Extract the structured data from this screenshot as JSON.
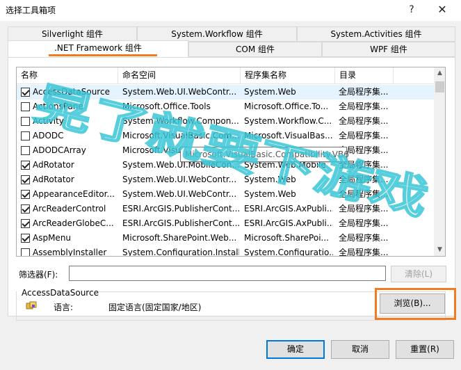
{
  "window": {
    "title": "选择工具箱项",
    "help_glyph": "?",
    "close_glyph": "✕"
  },
  "tabs": {
    "row1": [
      "Silverlight 组件",
      "System.Workflow 组件",
      "System.Activities 组件"
    ],
    "row2": [
      ".NET Framework 组件",
      "COM 组件",
      "WPF 组件"
    ],
    "active": ".NET Framework 组件"
  },
  "list": {
    "columns": [
      "名称",
      "命名空间",
      "程序集名称",
      "目录"
    ],
    "rows": [
      {
        "checked": true,
        "name": "AccessDataSource",
        "namespace": "System.Web.UI.WebContr...",
        "assembly": "System.Web",
        "dir": "全局程序集...",
        "selected": true
      },
      {
        "checked": false,
        "name": "ActionsPane",
        "namespace": "Microsoft.Office.Tools",
        "assembly": "Microsoft.Office.To...",
        "dir": "全局程序集..."
      },
      {
        "checked": false,
        "name": "Activity",
        "namespace": "System.Workflow.Compon...",
        "assembly": "System.Workflow.C...",
        "dir": "全局程序集..."
      },
      {
        "checked": false,
        "name": "ADODC",
        "namespace": "Microsoft.VisualBasic.Com...",
        "assembly": "Microsoft.VisualBas...",
        "dir": "全局程序集..."
      },
      {
        "checked": false,
        "name": "ADODCArray",
        "namespace": "Microsoft.Visual",
        "assembly": "",
        "dir": "全局程序集..."
      },
      {
        "checked": true,
        "name": "AdRotator",
        "namespace": "System.Web.UI.MobileCon...",
        "assembly": "System.Web.Mobile",
        "dir": "全局程序集..."
      },
      {
        "checked": true,
        "name": "AdRotator",
        "namespace": "System.Web.UI.WebContr...",
        "assembly": "System.Web",
        "dir": "全局程序集..."
      },
      {
        "checked": true,
        "name": "AppearanceEditor...",
        "namespace": "System.Web.UI.WebContr...",
        "assembly": "System.Web",
        "dir": "全局程序集..."
      },
      {
        "checked": true,
        "name": "ArcReaderControl",
        "namespace": "ESRI.ArcGIS.PublisherCont...",
        "assembly": "ESRI.ArcGIS.AxPubli...",
        "dir": "全局程序集..."
      },
      {
        "checked": true,
        "name": "ArcReaderGlobeC...",
        "namespace": "ESRI.ArcGIS.PublisherCont...",
        "assembly": "ESRI.ArcGIS.AxPubli...",
        "dir": "全局程序集..."
      },
      {
        "checked": true,
        "name": "AspMenu",
        "namespace": "Microsoft.SharePoint.Web...",
        "assembly": "Microsoft.SharePoi...",
        "dir": "全局程序集..."
      },
      {
        "checked": false,
        "name": "AssemblyInstaller",
        "namespace": "System.Configuration.Install",
        "assembly": "System.Configuratio...",
        "dir": "全局程序集..."
      }
    ],
    "tooltip": "Microsoft.VisualBasic.Compatibility.VB6",
    "scroll_up": "▲",
    "scroll_down": "▼"
  },
  "filter": {
    "label": "筛选器(F):",
    "value": "",
    "clear_label": "清除(L)"
  },
  "details": {
    "title": "AccessDataSource",
    "language_label": "语言:",
    "language_value": "固定语言(固定国家/地区)",
    "browse_label": "浏览(B)..."
  },
  "buttons": {
    "ok": "确定",
    "cancel": "取消",
    "reset": "重置(R)"
  },
  "watermark": {
    "text": "晃了就要下游戏"
  },
  "colors": {
    "highlight": "#f07c22",
    "default_button_border": "#0078d7",
    "watermark": "#39c6d6",
    "selected_row": "#e5f3ff"
  }
}
